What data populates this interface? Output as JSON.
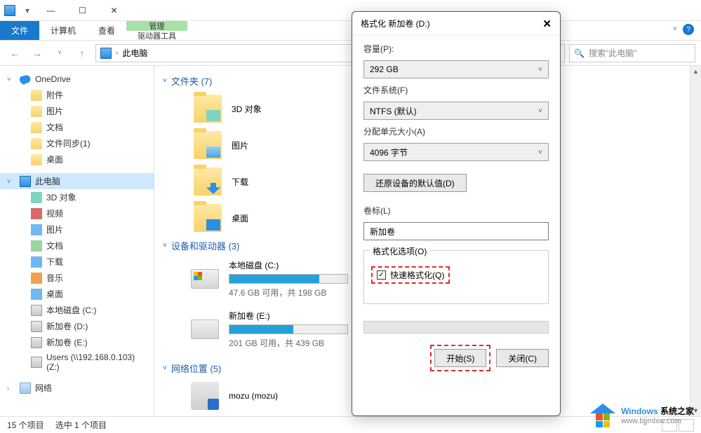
{
  "window": {
    "title": "此电脑",
    "min": "—",
    "max": "☐",
    "close": "✕"
  },
  "ribbon": {
    "file": "文件",
    "computer": "计算机",
    "view": "查看",
    "manage": "管理",
    "driverTools": "驱动器工具",
    "help": "?"
  },
  "nav": {
    "back": "←",
    "forward": "→",
    "up": "↑",
    "location": "此电脑",
    "refresh": "↻",
    "search_placeholder": "搜索\"此电脑\""
  },
  "tree": {
    "onedrive": "OneDrive",
    "children1": [
      "附件",
      "图片",
      "文档",
      "文件同步(1)",
      "桌面"
    ],
    "thispc": "此电脑",
    "children2": [
      "3D 对象",
      "视频",
      "图片",
      "文档",
      "下载",
      "音乐",
      "桌面",
      "本地磁盘 (C:)",
      "新加卷 (D:)",
      "新加卷 (E:)",
      "Users (\\\\192.168.0.103) (Z:)"
    ],
    "network": "网络"
  },
  "content": {
    "group_folders": "文件夹 (7)",
    "folders": [
      "3D 对象",
      "图片",
      "下载",
      "桌面"
    ],
    "group_drives": "设备和驱动器 (3)",
    "drives": [
      {
        "name": "本地磁盘 (C:)",
        "sub": "47.6 GB 可用，共 198 GB",
        "pct": 76
      },
      {
        "name": "新加卷 (E:)",
        "sub": "201 GB 可用，共 439 GB",
        "pct": 54
      }
    ],
    "group_net": "网络位置 (5)",
    "net": "mozu (mozu)"
  },
  "status": {
    "items": "15 个项目",
    "selected": "选中 1 个项目"
  },
  "dialog": {
    "title": "格式化 新加卷 (D:)",
    "capacity_label": "容量(P):",
    "capacity_value": "292 GB",
    "fs_label": "文件系统(F)",
    "fs_value": "NTFS (默认)",
    "alloc_label": "分配单元大小(A)",
    "alloc_value": "4096 字节",
    "restore": "还原设备的默认值(D)",
    "volume_label": "卷标(L)",
    "volume_value": "新加卷",
    "options_label": "格式化选项(O)",
    "quick_format": "快速格式化(Q)",
    "start": "开始(S)",
    "close_btn": "关闭(C)",
    "close_x": "✕"
  },
  "watermark": {
    "line1a": "Windows",
    "line1b": "系统之家",
    "line2": "www.bjjmlxw.com"
  }
}
